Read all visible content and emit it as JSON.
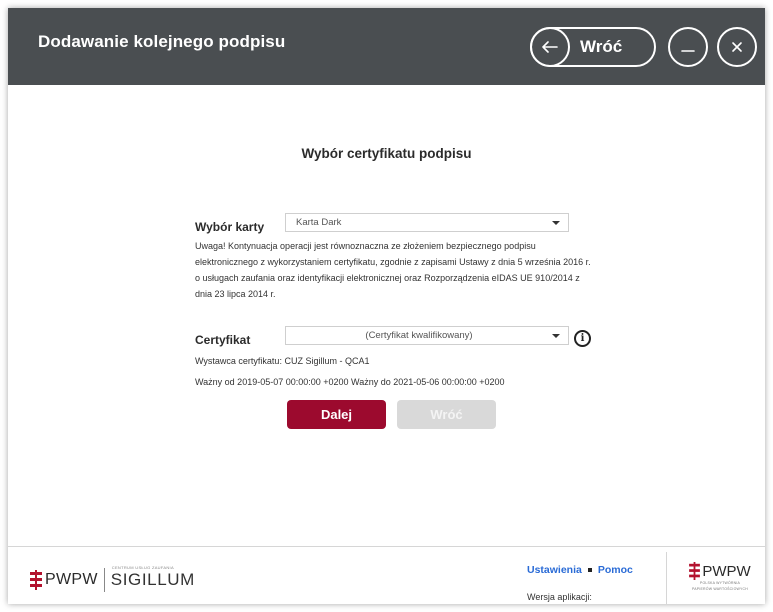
{
  "header": {
    "title": "Dodawanie kolejnego podpisu",
    "back_label": "Wróć"
  },
  "main": {
    "section_title": "Wybór certyfikatu podpisu",
    "card": {
      "label": "Wybór karty",
      "selected": "Karta Dark"
    },
    "notice": "Uwaga! Kontynuacja operacji jest równoznaczna ze złożeniem bezpiecznego podpisu elektronicznego z wykorzystaniem certyfikatu, zgodnie z zapisami Ustawy z dnia 5 września 2016 r. o usługach zaufania oraz identyfikacji elektronicznej oraz Rozporządzenia eIDAS UE 910/2014 z dnia 23 lipca 2014 r.",
    "certificate": {
      "label": "Certyfikat",
      "selected": "(Certyfikat kwalifikowany)"
    },
    "issuer_line": "Wystawca certyfikatu: CUZ Sigillum - QCA1",
    "validity_line": "Ważny od 2019-05-07 00:00:00 +0200 Ważny do 2021-05-06 00:00:00 +0200",
    "buttons": {
      "next": "Dalej",
      "back": "Wróć"
    }
  },
  "footer": {
    "logo_left_brand": "PWPW",
    "logo_left_small": "CENTRUM USŁUG ZAUFANIA",
    "logo_left_product": "SIGILLUM",
    "settings_link": "Ustawienia",
    "help_link": "Pomoc",
    "version_label": "Wersja aplikacji:",
    "logo_right_brand": "PWPW",
    "logo_right_tagline_1": "POLSKA WYTWÓRNIA",
    "logo_right_tagline_2": "PAPIERÓW WARTOŚCIOWYCH"
  },
  "colors": {
    "titlebar": "#4a4e51",
    "primary_button": "#9c0a2e",
    "disabled_button": "#d9d9d9",
    "link": "#2a6bd6",
    "brand_red": "#b3122e"
  },
  "icons": [
    "arrow-left-icon",
    "minimize-icon",
    "close-icon",
    "caret-down-icon",
    "info-icon",
    "pwpw-emblem-icon"
  ]
}
